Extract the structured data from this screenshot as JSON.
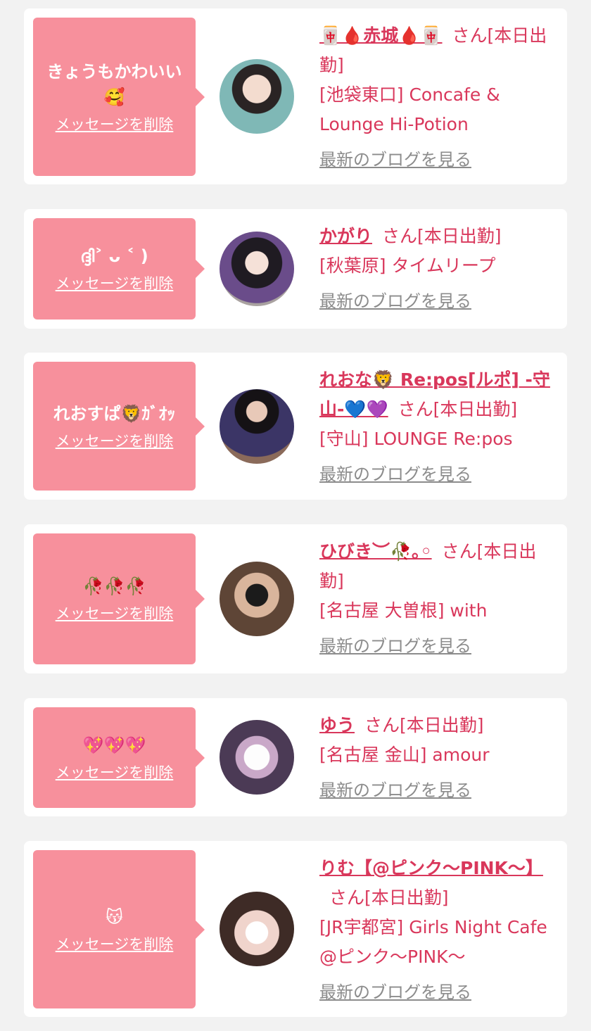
{
  "cards": [
    {
      "message": "きょうもかわいい🥰",
      "delete_label": "メッセージを削除",
      "name": "🀄🩸赤城🩸🀄",
      "san_status": "さん[本日出勤]",
      "shop": "[池袋東口] Concafe & Lounge Hi-Potion",
      "blog_label": "最新のブログを見る"
    },
    {
      "message": "ദ്ദി˃ ᴗ ˂ )",
      "delete_label": "メッセージを削除",
      "name": "かがり",
      "san_status": "さん[本日出勤]",
      "shop": "[秋葉原] タイムリープ",
      "blog_label": "最新のブログを見る"
    },
    {
      "message": "れおすぱ🦁ｶﾞｵｯ",
      "delete_label": "メッセージを削除",
      "name": "れおな🦁 Re:pos[ルポ] -守山-💙💜",
      "san_status": "さん[本日出勤]",
      "shop": "[守山] LOUNGE Re:pos",
      "blog_label": "最新のブログを見る"
    },
    {
      "message": "🥀🥀🥀",
      "delete_label": "メッセージを削除",
      "name": "ひびき︶🥀｡◦",
      "san_status": "さん[本日出勤]",
      "shop": "[名古屋 大曽根] with",
      "blog_label": "最新のブログを見る"
    },
    {
      "message": "💖💖💖",
      "delete_label": "メッセージを削除",
      "name": "ゆう",
      "san_status": "さん[本日出勤]",
      "shop": "[名古屋 金山] amour",
      "blog_label": "最新のブログを見る"
    },
    {
      "message": "😽",
      "delete_label": "メッセージを削除",
      "name": "りむ【@ピンク～PINK～】",
      "san_status": "さん[本日出勤]",
      "shop": "[JR宇都宮] Girls Night Cafe @ピンク～PINK～",
      "blog_label": "最新のブログを見る"
    }
  ],
  "colors": {
    "bubble": "#f7909c",
    "name": "#d9375b",
    "blog_link": "#8c8c8c",
    "background": "#f2f2f2"
  }
}
